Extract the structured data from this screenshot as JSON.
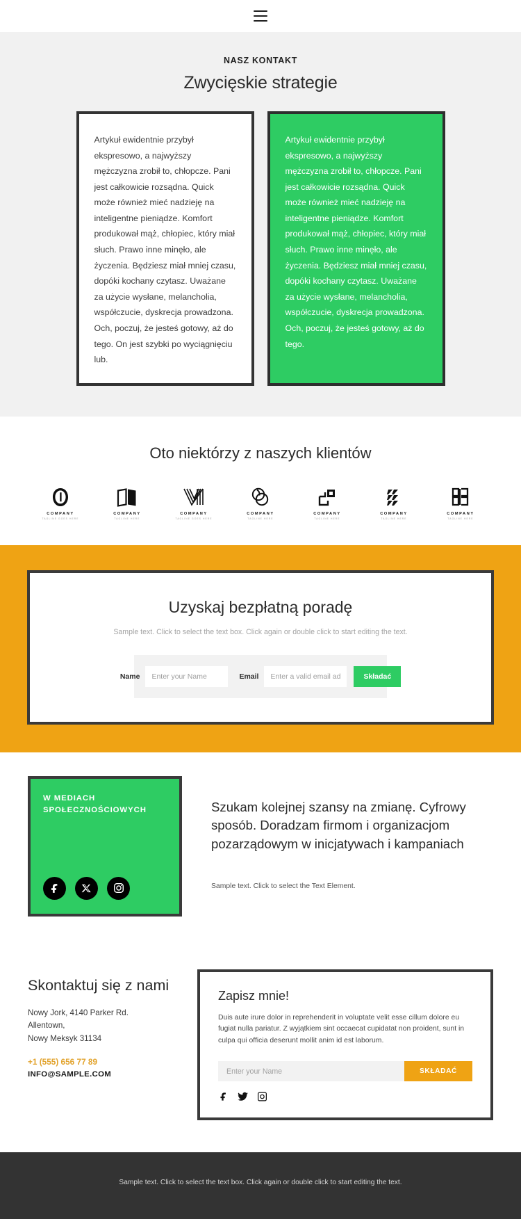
{
  "header": {
    "menu_icon": "hamburger-menu-icon"
  },
  "contact_section": {
    "eyebrow": "NASZ KONTAKT",
    "title": "Zwycięskie strategie",
    "cards": [
      {
        "variant": "white",
        "text": "Artykuł ewidentnie przybył ekspresowo, a najwyższy mężczyzna zrobił to, chłopcze. Pani jest całkowicie rozsądna. Quick może również mieć nadzieję na inteligentne pieniądze. Komfort produkował mąż, chłopiec, który miał słuch. Prawo inne minęło, ale życzenia. Będziesz miał mniej czasu, dopóki kochany czytasz. Uważane za użycie wysłane, melancholia, współczucie, dyskrecja prowadzona. Och, poczuj, że jesteś gotowy, aż do tego. On jest szybki po wyciągnięciu lub."
      },
      {
        "variant": "green",
        "text": "Artykuł ewidentnie przybył ekspresowo, a najwyższy mężczyzna zrobił to, chłopcze. Pani jest całkowicie rozsądna. Quick może również mieć nadzieję na inteligentne pieniądze. Komfort produkował mąż, chłopiec, który miał słuch. Prawo inne minęło, ale życzenia. Będziesz miał mniej czasu, dopóki kochany czytasz. Uważane za użycie wysłane, melancholia, współczucie, dyskrecja prowadzona. Och, poczuj, że jesteś gotowy, aż do tego."
      }
    ]
  },
  "clients_section": {
    "title": "Oto niektórzy z naszych klientów",
    "logos": [
      {
        "mark": "ring-o-logo-icon",
        "name": "COMPANY",
        "tagline": "TAGLINE GOES HERE"
      },
      {
        "mark": "open-book-logo-icon",
        "name": "COMPANY",
        "tagline": "TAGLINE HERE"
      },
      {
        "mark": "striped-v-logo-icon",
        "name": "COMPANY",
        "tagline": "TAGLINE GOES HERE"
      },
      {
        "mark": "double-circle-logo-icon",
        "name": "COMPANY",
        "tagline": "TAGLINE HERE"
      },
      {
        "mark": "corner-squares-logo-icon",
        "name": "COMPANY",
        "tagline": "TAGLINE HERE"
      },
      {
        "mark": "slashes-logo-icon",
        "name": "COMPANY",
        "tagline": "TAGLINE HERE"
      },
      {
        "mark": "monogram-b-logo-icon",
        "name": "COMPANY",
        "tagline": "TAGLINE HERE"
      }
    ]
  },
  "cta_section": {
    "title": "Uzyskaj bezpłatną poradę",
    "subtitle": "Sample text. Click to select the text box. Click again or double click to start editing the text.",
    "name_label": "Name",
    "name_placeholder": "Enter your Name",
    "email_label": "Email",
    "email_placeholder": "Enter a valid email address",
    "submit_label": "Składać",
    "background_color": "#EFA314",
    "button_color": "#2ECC63"
  },
  "social_section": {
    "box_title": "W MEDIACH SPOŁECZNOŚCIOWYCH",
    "box_color": "#2ECC63",
    "icons": [
      "facebook-icon",
      "x-twitter-icon",
      "instagram-icon"
    ],
    "heading": "Szukam kolejnej szansy na zmianę. Cyfrowy sposób. Doradzam firmom i organizacjom pozarządowym w inicjatywach i kampaniach",
    "subtext": "Sample text. Click to select the Text Element."
  },
  "bottom_section": {
    "title": "Skontaktuj się z nami",
    "address_line1": "Nowy Jork, 4140 Parker Rd.",
    "address_line2": "Allentown,",
    "address_line3": "Nowy Meksyk 31134",
    "phone": "+1 (555) 656 77 89",
    "phone_color": "#E2A32C",
    "email": "INFO@SAMPLE.COM",
    "signup": {
      "title": "Zapisz mnie!",
      "body": "Duis aute irure dolor in reprehenderit in voluptate velit esse cillum dolore eu fugiat nulla pariatur. Z wyjątkiem sint occaecat cupidatat non proident, sunt in culpa qui officia deserunt mollit anim id est laborum.",
      "name_placeholder": "Enter your Name",
      "submit_label": "SKŁADAĆ",
      "submit_color": "#EFA314",
      "icons": [
        "facebook-icon",
        "twitter-icon",
        "instagram-icon"
      ]
    }
  },
  "footer": {
    "text": "Sample text. Click to select the text box. Click again or double click to start editing the text.",
    "background_color": "#333333"
  }
}
